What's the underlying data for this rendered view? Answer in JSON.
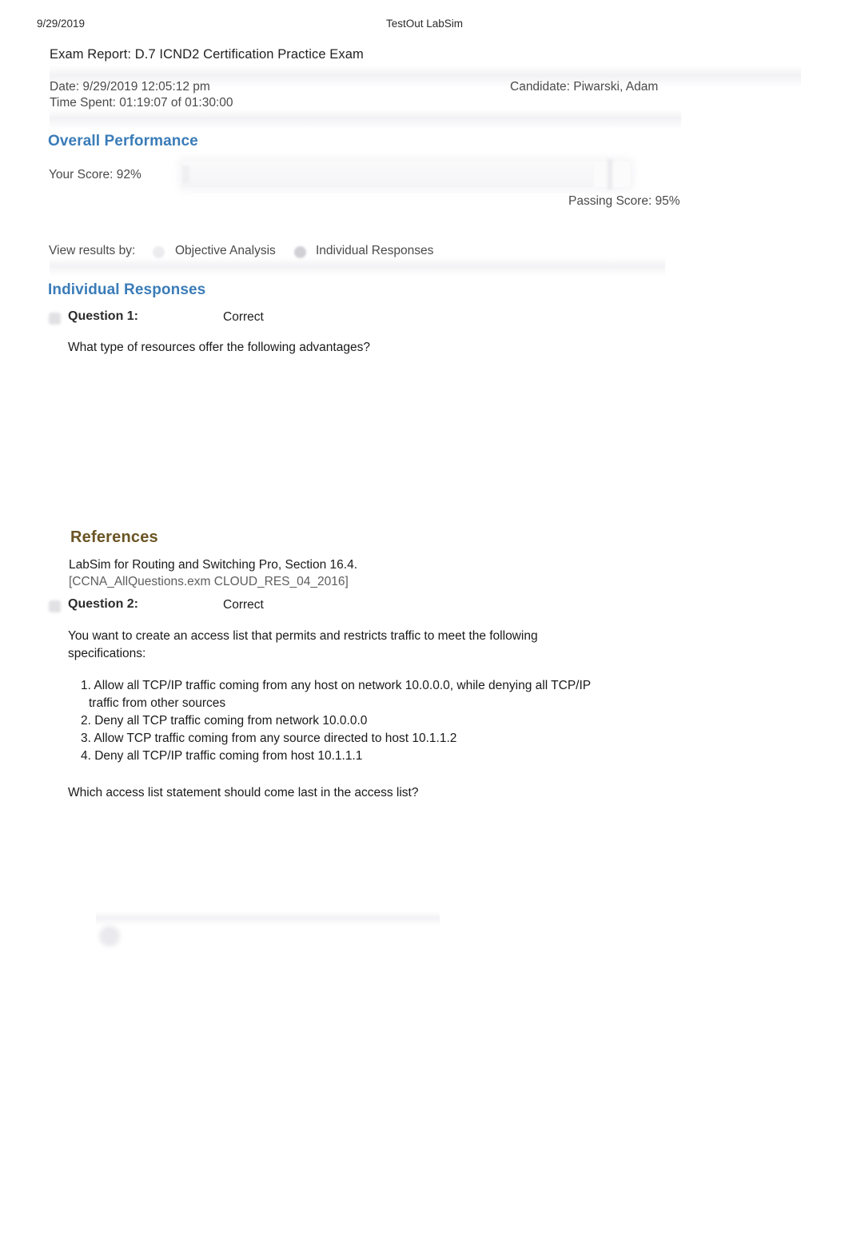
{
  "print_header": {
    "date": "9/29/2019",
    "app_name": "TestOut LabSim"
  },
  "report": {
    "title": "Exam Report: D.7 ICND2 Certification Practice Exam",
    "date_line": "Date: 9/29/2019 12:05:12 pm",
    "time_spent_line": "Time Spent: 01:19:07 of 01:30:00",
    "candidate_line": "Candidate: Piwarski, Adam"
  },
  "overall_performance": {
    "heading": "Overall Performance",
    "your_score_label": "Your Score: 92%",
    "your_score_percent": 92,
    "passing_score_label": "Passing Score:  95%",
    "passing_score_percent": 95
  },
  "view_results_by": {
    "label": "View results by:",
    "options": [
      {
        "label": "Objective Analysis",
        "selected": false
      },
      {
        "label": "Individual Responses",
        "selected": true
      }
    ]
  },
  "individual_responses": {
    "heading": "Individual Responses",
    "questions": [
      {
        "label": "Question 1:",
        "result": "Correct",
        "status_icon": "correct-check-icon",
        "prompt": "What type of resources offer the following advantages?",
        "references": {
          "heading": "References",
          "source": "LabSim for Routing and Switching Pro, Section 16.4.",
          "citation": "[CCNA_AllQuestions.exm CLOUD_RES_04_2016]"
        }
      },
      {
        "label": "Question 2:",
        "result": "Correct",
        "status_icon": "correct-check-icon",
        "prompt": "You want to create an access list that permits and restricts traffic to meet the following specifications:",
        "specifications": [
          "1. Allow all TCP/IP traffic coming from any host on network 10.0.0.0, while denying all TCP/IP traffic from other sources",
          "2. Deny all TCP traffic coming from network 10.0.0.0",
          "3. Allow TCP traffic coming from any source directed to host 10.1.1.2",
          "4. Deny all TCP/IP traffic coming from host 10.1.1.1"
        ],
        "trailing_prompt": "Which access list statement should come last in the access list?"
      }
    ]
  },
  "colors": {
    "section_heading": "#3a7cb8",
    "references_heading": "#6b5524",
    "body_text": "#1a1a1a",
    "muted_text": "#4a4a4a"
  }
}
